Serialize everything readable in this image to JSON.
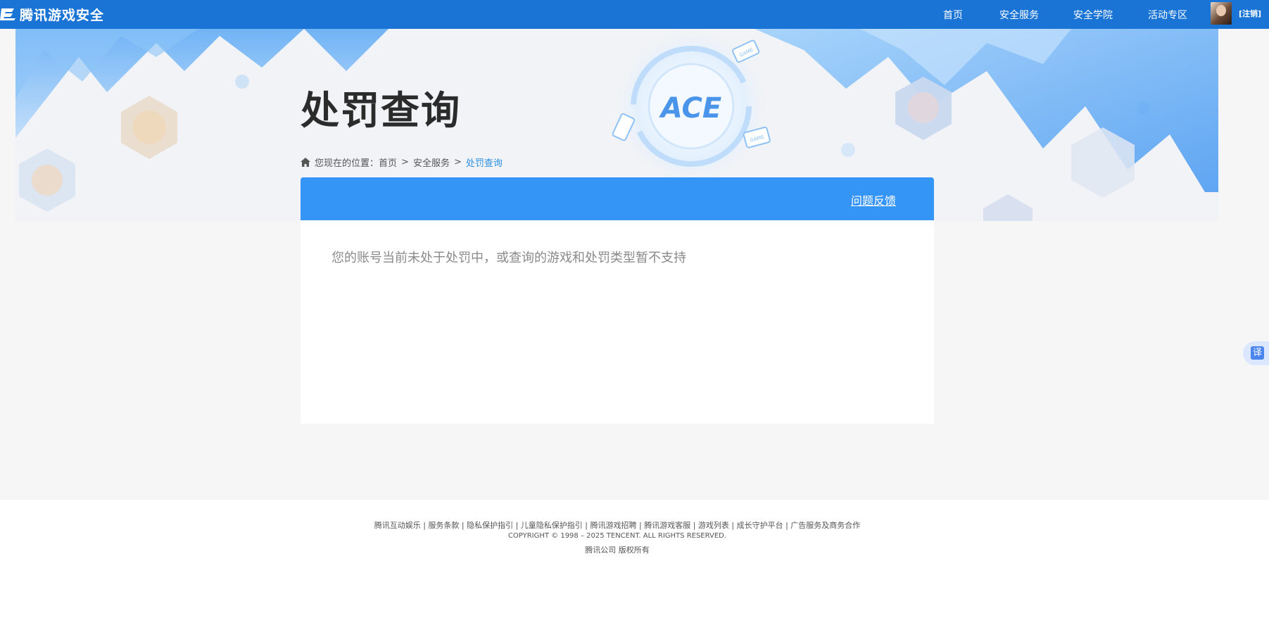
{
  "header": {
    "logo_text": "腾讯游戏安全",
    "nav": [
      "首页",
      "安全服务",
      "安全学院",
      "活动专区"
    ],
    "logout_label": "[注销]"
  },
  "banner": {
    "ace_text": "ACE",
    "badge_text": "GAME"
  },
  "page": {
    "title": "处罚查询",
    "breadcrumb": {
      "prefix": "您现在的位置：",
      "items": [
        "首页",
        "安全服务",
        "处罚查询"
      ],
      "separator": ">"
    },
    "feedback_label": "问题反馈",
    "notice": "您的账号当前未处于处罚中，或查询的游戏和处罚类型暂不支持"
  },
  "translate_label": "译",
  "footer": {
    "links_text": "腾讯互动娱乐 | 服务条款 | 隐私保护指引 | 儿童隐私保护指引 | 腾讯游戏招聘 | 腾讯游戏客服 | 游戏列表 | 成长守护平台 | 广告服务及商务合作",
    "copyright": "COPYRIGHT © 1998 – 2025 TENCENT. ALL RIGHTS RESERVED.",
    "company": "腾讯公司 版权所有"
  },
  "colors": {
    "topbar": "#1a74d6",
    "panel_header": "#3595f7",
    "link_active": "#2d8fe5"
  }
}
